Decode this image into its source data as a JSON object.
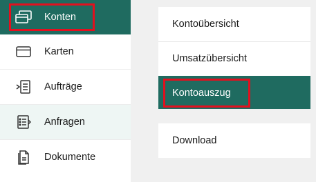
{
  "sidebar": {
    "items": [
      {
        "label": "Konten",
        "icon": "accounts-icon",
        "state": "active"
      },
      {
        "label": "Karten",
        "icon": "card-icon",
        "state": "normal"
      },
      {
        "label": "Aufträge",
        "icon": "orders-icon",
        "state": "normal"
      },
      {
        "label": "Anfragen",
        "icon": "requests-icon",
        "state": "hover"
      },
      {
        "label": "Dokumente",
        "icon": "documents-icon",
        "state": "normal"
      }
    ]
  },
  "submenu": {
    "items": [
      {
        "label": "Kontoübersicht",
        "state": "normal"
      },
      {
        "label": "Umsatzübersicht",
        "state": "normal"
      },
      {
        "label": "Kontoauszug",
        "state": "active"
      }
    ],
    "download_label": "Download"
  },
  "colors": {
    "accent": "#1f6b60",
    "highlight_box": "#e3101e",
    "hover_bg": "#eef6f4",
    "background": "#f0f0f0"
  }
}
